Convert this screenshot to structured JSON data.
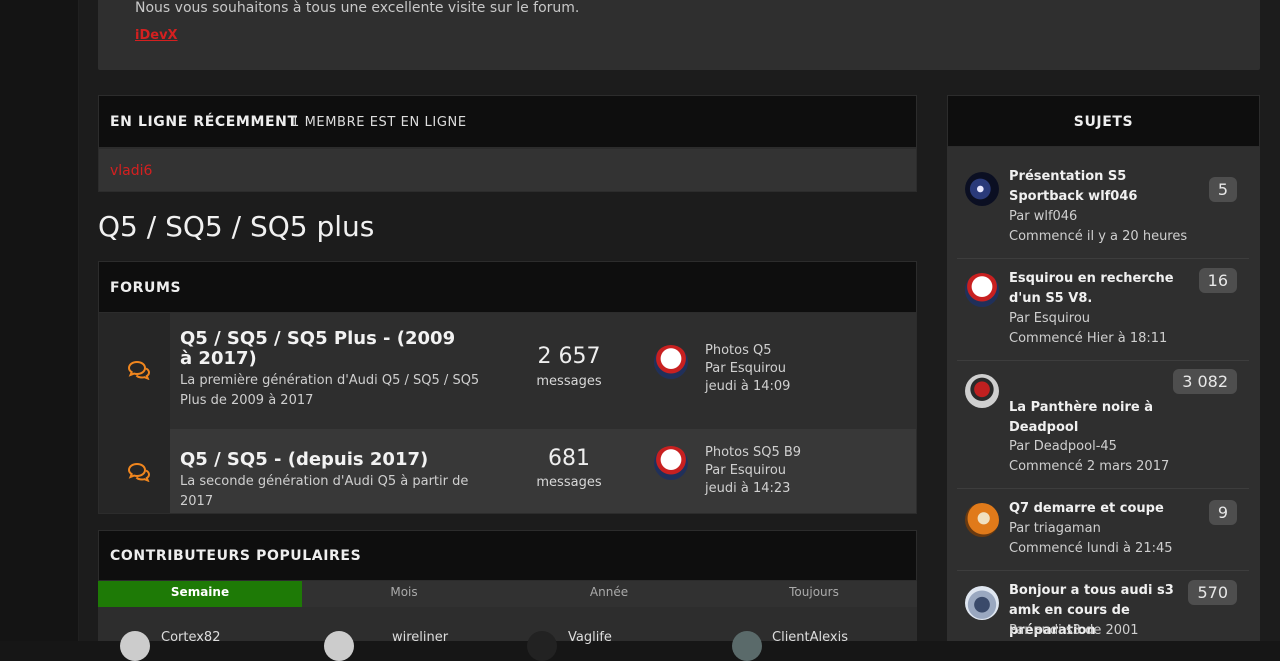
{
  "welcome": {
    "text": "Nous vous souhaitons à tous une excellente visite sur le forum.",
    "signature": "iDevX"
  },
  "online": {
    "title": "EN LIGNE RÉCEMMENT",
    "count": "1 MEMBRE EST EN LIGNE",
    "users": [
      "vladi6"
    ]
  },
  "page_title": "Q5 / SQ5 / SQ5 plus",
  "forums": {
    "title": "FORUMS",
    "rows": [
      {
        "title": "Q5 / SQ5 / SQ5 Plus - (2009 à 2017)",
        "desc": "La première génération d'Audi Q5 / SQ5 / SQ5 Plus de 2009 à 2017",
        "count": "2 657",
        "count_label": "messages",
        "last_title": "Photos Q5",
        "last_by": "Par Esquirou",
        "last_date": "jeudi à 14:09"
      },
      {
        "title": "Q5 / SQ5 - (depuis 2017)",
        "desc": "La seconde génération d'Audi Q5 à partir de 2017",
        "count": "681",
        "count_label": "messages",
        "last_title": "Photos SQ5 B9",
        "last_by": "Par Esquirou",
        "last_date": "jeudi à 14:23"
      }
    ]
  },
  "contributors": {
    "title": "CONTRIBUTEURS POPULAIRES",
    "tabs": [
      "Semaine",
      "Mois",
      "Année",
      "Toujours"
    ],
    "active_tab": "Semaine",
    "users": [
      "Cortex82",
      "wireliner",
      "Vaglife",
      "ClientAlexis"
    ]
  },
  "sujets": {
    "title": "SUJETS",
    "topics": [
      {
        "title": "Présentation S5 Sportback wlf046",
        "by": "Par wlf046",
        "started": "Commencé il y a 20 heures",
        "badge": "5"
      },
      {
        "title": "Esquirou en recherche d'un S5 V8.",
        "by": "Par Esquirou",
        "started": "Commencé Hier à 18:11",
        "badge": "16"
      },
      {
        "title": "La Panthère noire à Deadpool",
        "title_extra": ".",
        "by": "Par Deadpool-45",
        "started": "Commencé 2 mars 2017",
        "badge": "3 082"
      },
      {
        "title": "Q7 demarre et coupe",
        "by": "Par triagaman",
        "started": "Commencé lundi à 21:45",
        "badge": "9"
      },
      {
        "title": "Bonjour a tous audi s3 amk en cours de préparation",
        "by": "Par audi s3 de 2001",
        "badge": "570"
      }
    ]
  },
  "colors": {
    "accent_green": "#1e7a06",
    "link_red": "#d42020",
    "icon_orange": "#f0861e"
  }
}
